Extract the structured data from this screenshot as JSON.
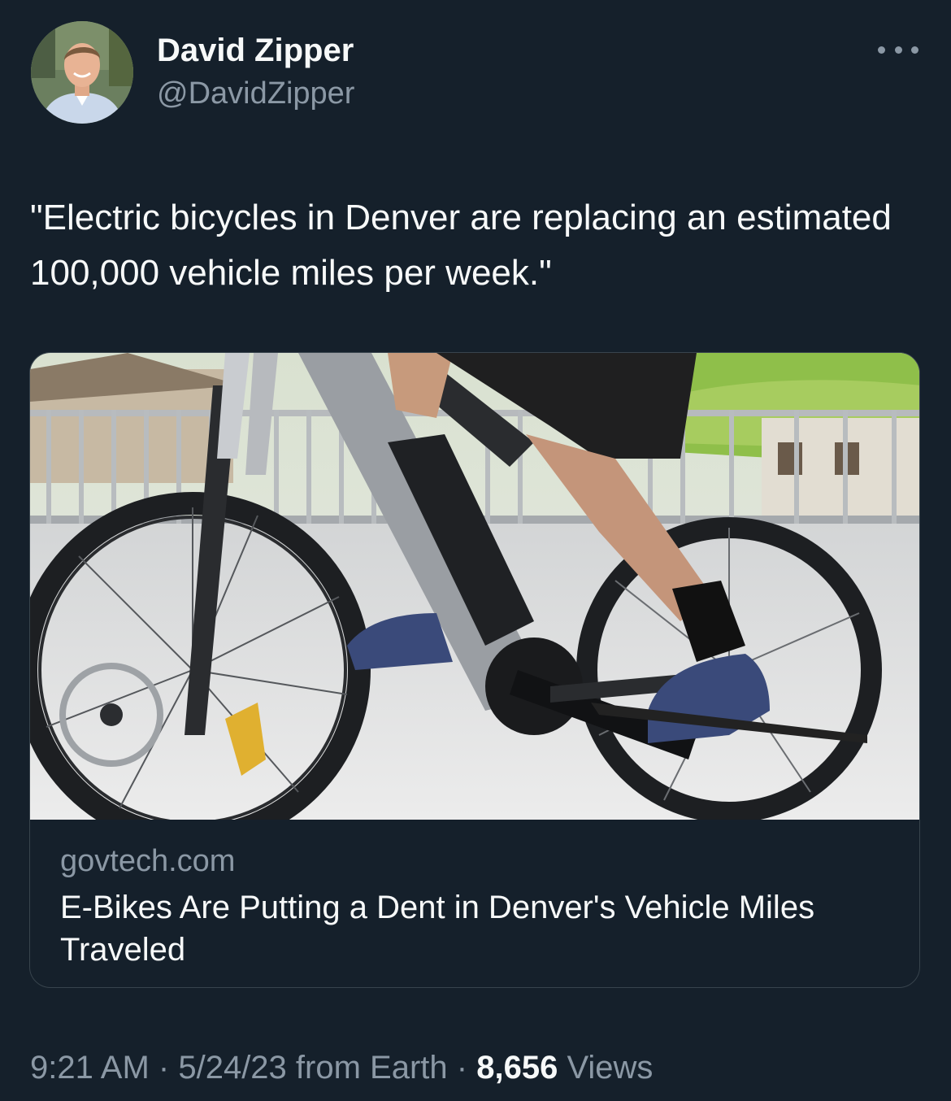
{
  "author": {
    "display_name": "David Zipper",
    "handle": "@DavidZipper",
    "avatar_icon": "person-avatar"
  },
  "more_icon": "ellipsis-icon",
  "tweet": {
    "text": "\"Electric bicycles in Denver are replacing an estimated 100,000 vehicle miles per week.\""
  },
  "link_card": {
    "image_description_icon": "ebike-photo",
    "domain": "govtech.com",
    "title": "E-Bikes Are Putting a Dent in Denver's Vehicle Miles Traveled"
  },
  "meta": {
    "time": "9:21 AM",
    "separator": "·",
    "date_source": "5/24/23 from Earth",
    "views_count": "8,656",
    "views_label": "Views"
  },
  "colors": {
    "background": "#15202b",
    "text_primary": "#f7f9f9",
    "text_secondary": "#8b98a5",
    "border": "#38444d"
  }
}
